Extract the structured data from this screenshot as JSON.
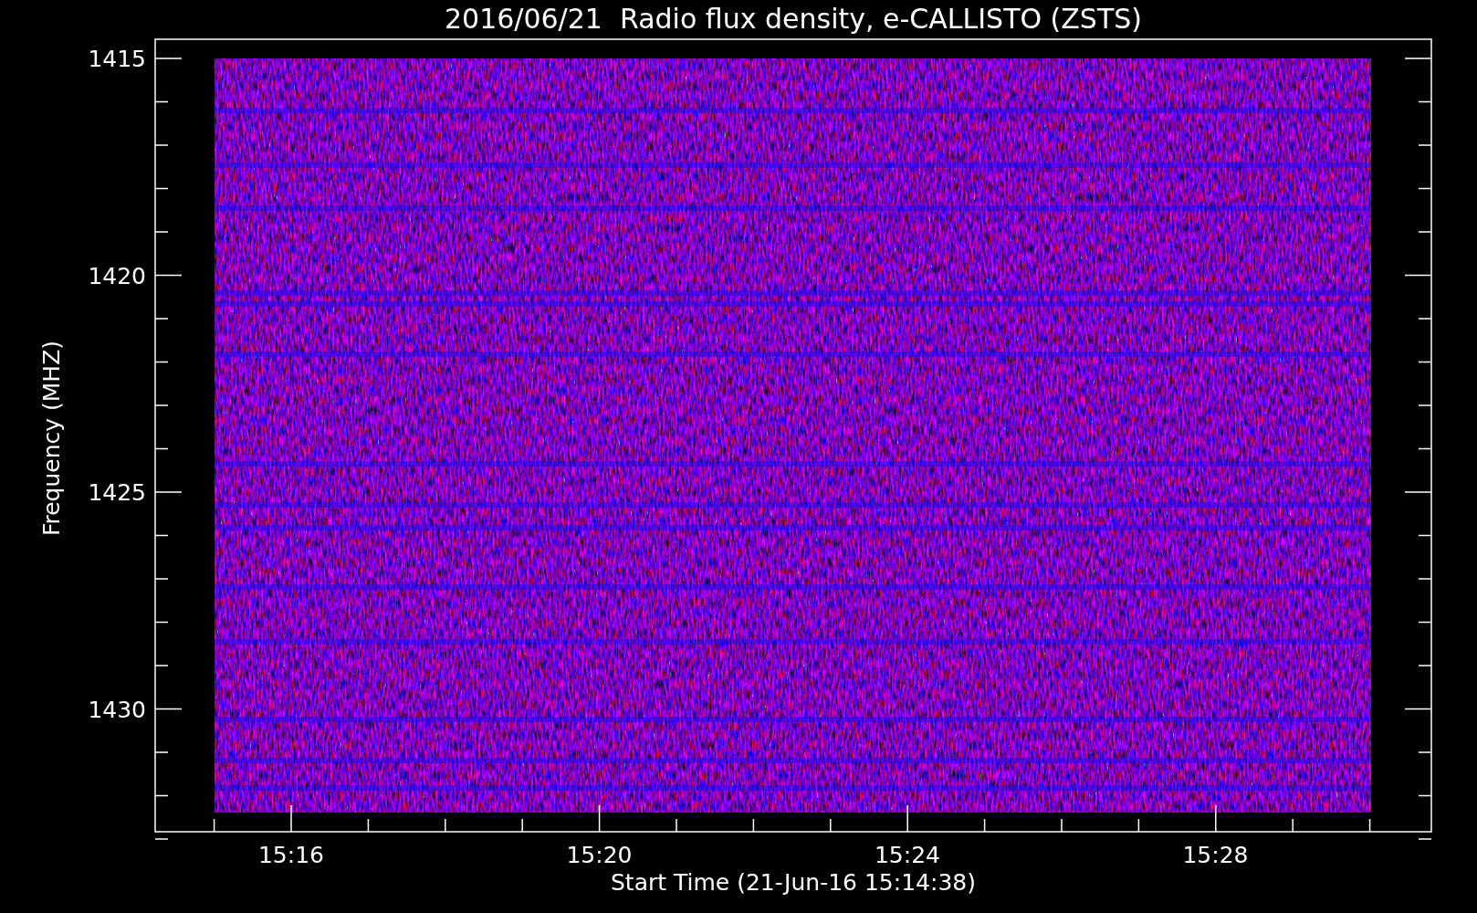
{
  "title": "2016/06/21  Radio flux density, e-CALLISTO (ZSTS)",
  "plot": {
    "ylabel": "Frequency (MHZ)",
    "xlabel": "Start Time (21-Jun-16 15:14:38)",
    "yticks": [
      "1415",
      "1420",
      "1425",
      "1430"
    ],
    "xticks": [
      "15:16",
      "15:20",
      "15:24",
      "15:28"
    ]
  }
}
